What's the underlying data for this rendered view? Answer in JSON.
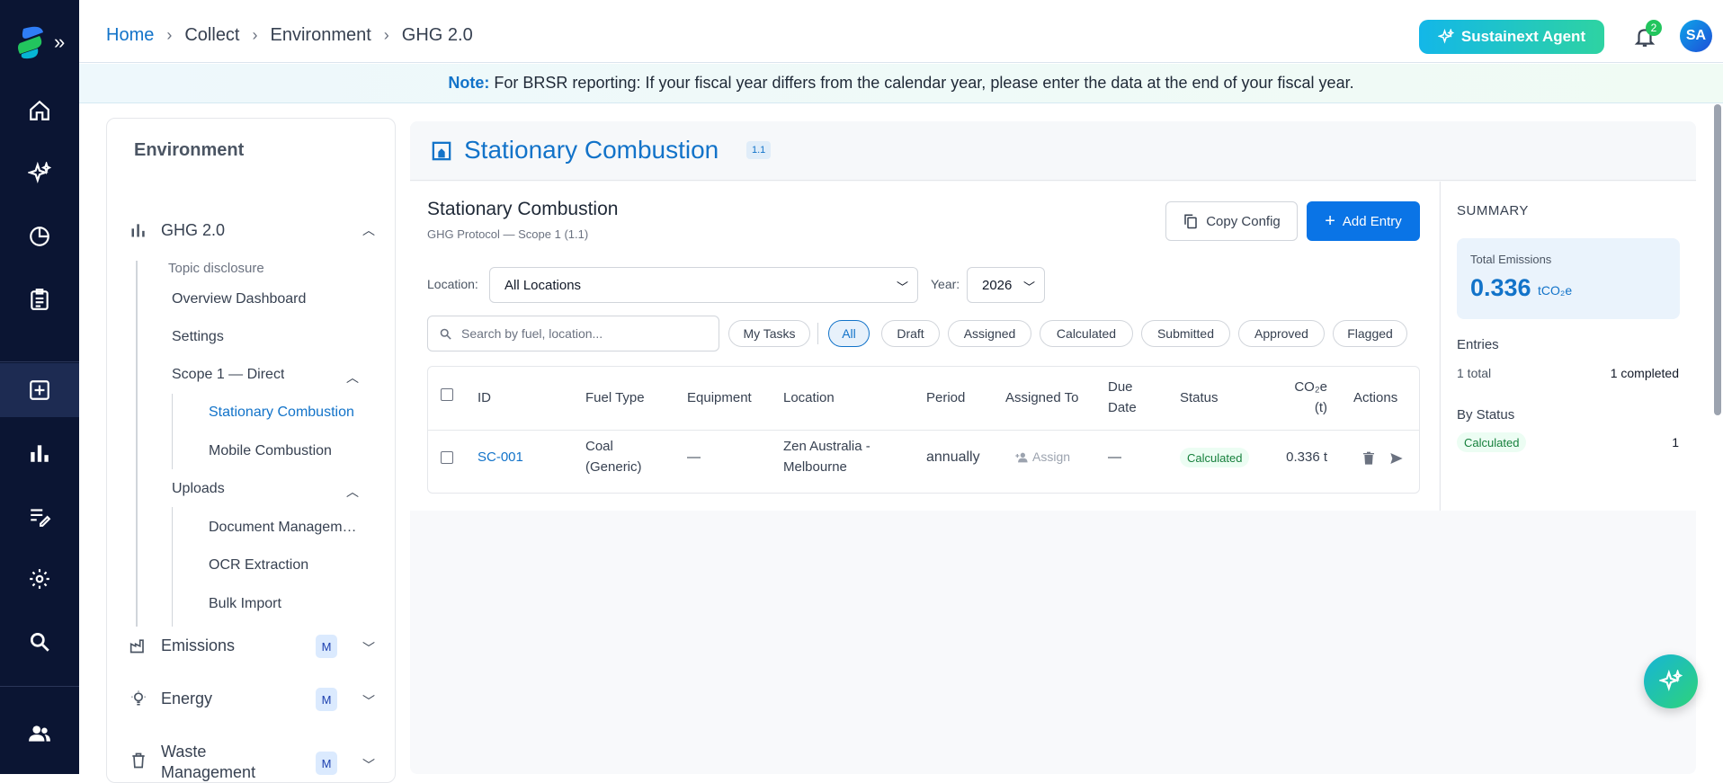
{
  "breadcrumb": {
    "home": "Home",
    "collect": "Collect",
    "environment": "Environment",
    "current": "GHG 2.0"
  },
  "header": {
    "agent_label": "Sustainext Agent",
    "notification_count": "2",
    "avatar_initials": "SA"
  },
  "note": {
    "prefix": "Note:",
    "text": "For BRSR reporting: If your fiscal year differs from the calendar year, please enter the data at the end of your fiscal year."
  },
  "nav": {
    "title": "Environment",
    "ghg": "GHG 2.0",
    "topic_disclosure": "Topic disclosure",
    "overview": "Overview Dashboard",
    "settings": "Settings",
    "scope1": "Scope 1 — Direct",
    "stationary": "Stationary Combustion",
    "mobile": "Mobile Combustion",
    "uploads": "Uploads",
    "document_mgmt": "Document Management",
    "ocr": "OCR Extraction",
    "bulk": "Bulk Import",
    "emissions": "Emissions",
    "energy": "Energy",
    "waste_line1": "Waste",
    "waste_line2": "Management",
    "m_badge": "M"
  },
  "page": {
    "title": "Stationary Combustion",
    "badge": "1.1"
  },
  "content": {
    "title": "Stationary Combustion",
    "subtitle": "GHG Protocol — Scope 1 (1.1)",
    "copy_config": "Copy Config",
    "add_entry": "Add Entry",
    "location_label": "Location:",
    "location_value": "All Locations",
    "year_label": "Year:",
    "year_value": "2026",
    "search_placeholder": "Search by fuel, location...",
    "filters": {
      "my_tasks": "My Tasks",
      "all": "All",
      "draft": "Draft",
      "assigned": "Assigned",
      "calculated": "Calculated",
      "submitted": "Submitted",
      "approved": "Approved",
      "flagged": "Flagged"
    }
  },
  "table": {
    "headers": {
      "id": "ID",
      "fuel": "Fuel Type",
      "equipment": "Equipment",
      "location": "Location",
      "period": "Period",
      "assigned": "Assigned To",
      "due_1": "Due",
      "due_2": "Date",
      "status": "Status",
      "co2_1": "CO₂e",
      "co2_2": "(t)",
      "actions": "Actions"
    },
    "rows": [
      {
        "id": "SC-001",
        "fuel_1": "Coal",
        "fuel_2": "(Generic)",
        "equipment": "—",
        "location_1": "Zen Australia -",
        "location_2": "Melbourne",
        "period": "annually",
        "assign": "Assign",
        "due": "—",
        "status": "Calculated",
        "co2": "0.336 t"
      }
    ]
  },
  "summary": {
    "heading": "SUMMARY",
    "total_label": "Total Emissions",
    "total_value": "0.336",
    "total_unit": "tCO₂e",
    "entries_label": "Entries",
    "entries_total": "1 total",
    "entries_completed": "1 completed",
    "by_status_label": "By Status",
    "status_name": "Calculated",
    "status_count": "1"
  },
  "colors": {
    "accent": "#1273c9",
    "rail": "#0b1533",
    "primary_button": "#0a74e6",
    "status_green": "#16803c"
  }
}
